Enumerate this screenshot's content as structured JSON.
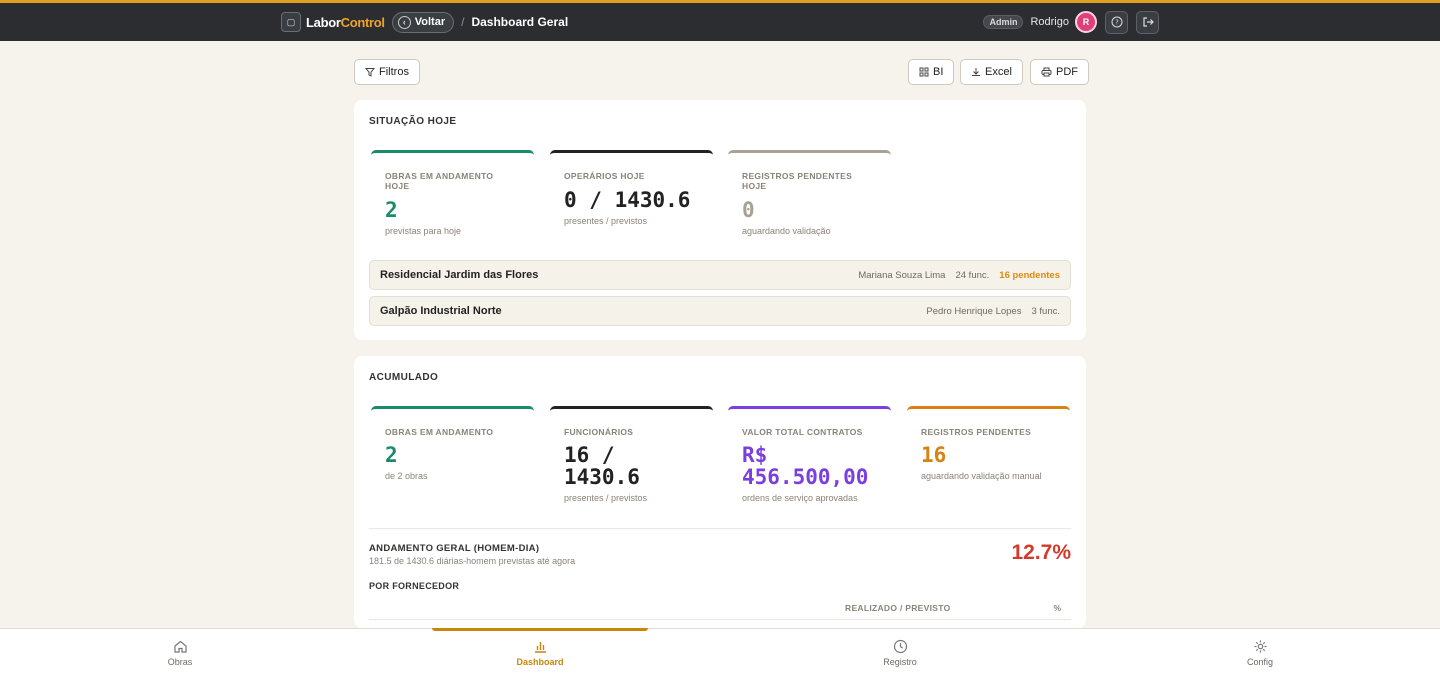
{
  "header": {
    "brand_part1": "Labor",
    "brand_part2": "Control",
    "back_label": "Voltar",
    "separator": "/",
    "page_title": "Dashboard Geral",
    "role_badge": "Admin",
    "user_name": "Rodrigo",
    "avatar_initial": "R"
  },
  "toolbar": {
    "filters_label": "Filtros",
    "bi_label": "BI",
    "excel_label": "Excel",
    "pdf_label": "PDF"
  },
  "today": {
    "section_title": "SITUAÇÃO HOJE",
    "kpis": [
      {
        "label": "OBRAS EM ANDAMENTO HOJE",
        "value": "2",
        "sub": "previstas para hoje",
        "color": "#1a8a6a"
      },
      {
        "label": "OPERÁRIOS HOJE",
        "value": "0 / 1430.6",
        "sub": "presentes / previstos",
        "color": "#222222"
      },
      {
        "label": "REGISTROS PENDENTES HOJE",
        "value": "0",
        "sub": "aguardando validação",
        "color": "#a8a294"
      }
    ],
    "sites": [
      {
        "name": "Residencial Jardim das Flores",
        "manager": "Mariana Souza Lima",
        "workers": "24 func.",
        "pending": "16 pendentes"
      },
      {
        "name": "Galpão Industrial Norte",
        "manager": "Pedro Henrique Lopes",
        "workers": "3 func.",
        "pending": ""
      }
    ]
  },
  "accumulated": {
    "section_title": "ACUMULADO",
    "kpis": [
      {
        "label": "OBRAS EM ANDAMENTO",
        "value": "2",
        "sub": "de 2 obras",
        "color": "#1a8a6a"
      },
      {
        "label": "FUNCIONÁRIOS",
        "value": "16 / 1430.6",
        "sub": "presentes / previstos",
        "color": "#222222"
      },
      {
        "label": "VALOR TOTAL CONTRATOS",
        "value": "R$ 456.500,00",
        "sub": "ordens de serviço aprovadas",
        "color": "#7a3fe0"
      },
      {
        "label": "REGISTROS PENDENTES",
        "value": "16",
        "sub": "aguardando validação manual",
        "color": "#d98214"
      }
    ],
    "progress_title": "ANDAMENTO GERAL (HOMEM-DIA)",
    "progress_sub": "181.5 de 1430.6 diárias-homem previstas até agora",
    "progress_pct": "12.7%",
    "progress_pct_color": "#d23a2b",
    "suppliers_title": "POR FORNECEDOR",
    "col_realized": "REALIZADO / PREVISTO",
    "col_pct": "%"
  },
  "bottom_nav": {
    "items": [
      {
        "label": "Obras",
        "icon": "home-icon"
      },
      {
        "label": "Dashboard",
        "icon": "bar-chart-icon",
        "active": true
      },
      {
        "label": "Registro",
        "icon": "clock-icon"
      },
      {
        "label": "Config",
        "icon": "gear-icon"
      }
    ]
  }
}
